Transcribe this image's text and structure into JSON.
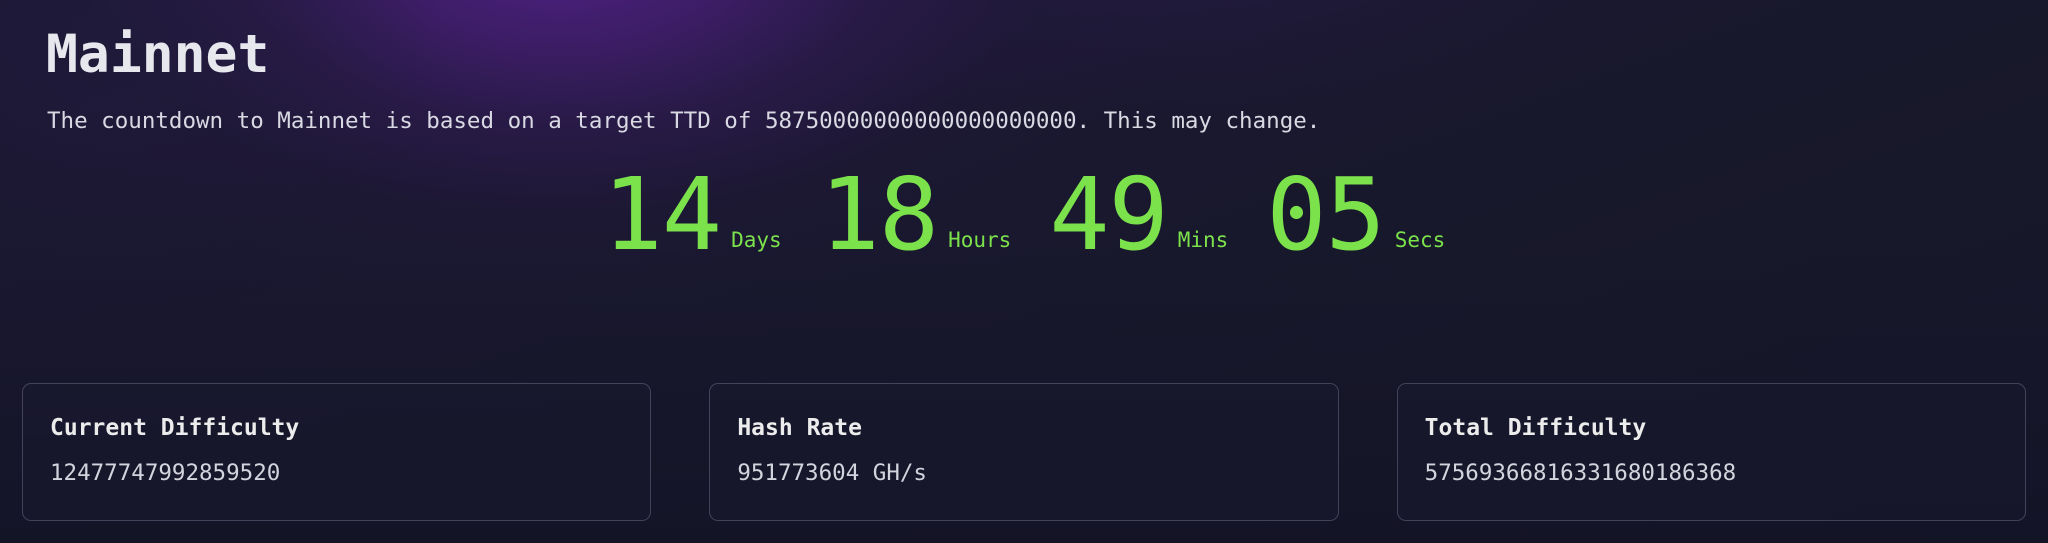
{
  "header": {
    "title": "Mainnet",
    "subtitle": "The countdown to Mainnet is based on a target TTD of 58750000000000000000000. This may change."
  },
  "countdown": {
    "accent_color": "#7ce24c",
    "units": [
      {
        "value": "14",
        "label": "Days"
      },
      {
        "value": "18",
        "label": "Hours"
      },
      {
        "value": "49",
        "label": "Mins"
      },
      {
        "value": "05",
        "label": "Secs"
      }
    ]
  },
  "stats": {
    "cards": [
      {
        "label": "Current Difficulty",
        "value": "12477747992859520"
      },
      {
        "label": "Hash Rate",
        "value": "951773604 GH/s"
      },
      {
        "label": "Total Difficulty",
        "value": "57569366816331680186368"
      }
    ]
  },
  "theme": {
    "background_dark": "#15162a",
    "background_purple": "#4b2286",
    "text_primary": "#e7e7ee",
    "text_secondary": "#d4d4de",
    "card_border": "#aaaac8"
  }
}
